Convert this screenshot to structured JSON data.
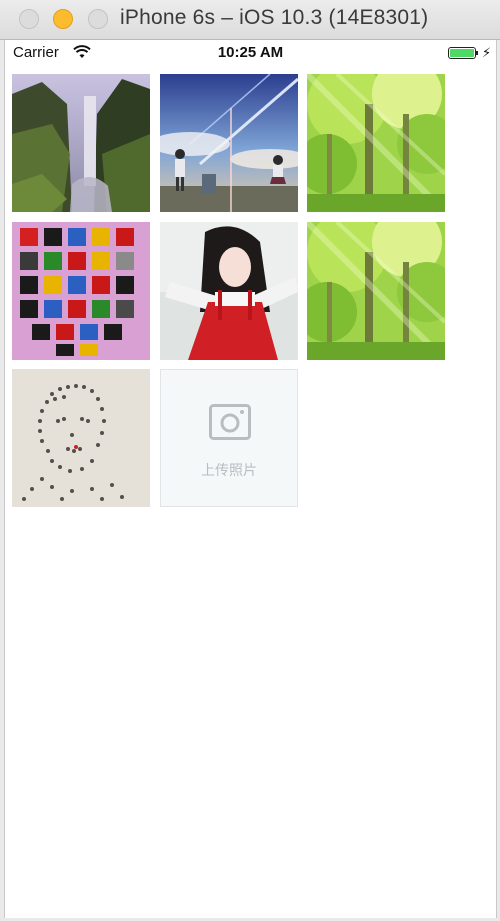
{
  "window": {
    "title": "iPhone 6s – iOS 10.3 (14E8301)"
  },
  "status_bar": {
    "carrier": "Carrier",
    "time": "10:25 AM"
  },
  "gallery": {
    "photos": [
      {
        "name": "waterfall"
      },
      {
        "name": "anime-couple"
      },
      {
        "name": "forest"
      },
      {
        "name": "alphabet-poster"
      },
      {
        "name": "girl-portrait"
      },
      {
        "name": "forest"
      },
      {
        "name": "crowd-portrait"
      }
    ],
    "upload_label": "上传照片"
  }
}
